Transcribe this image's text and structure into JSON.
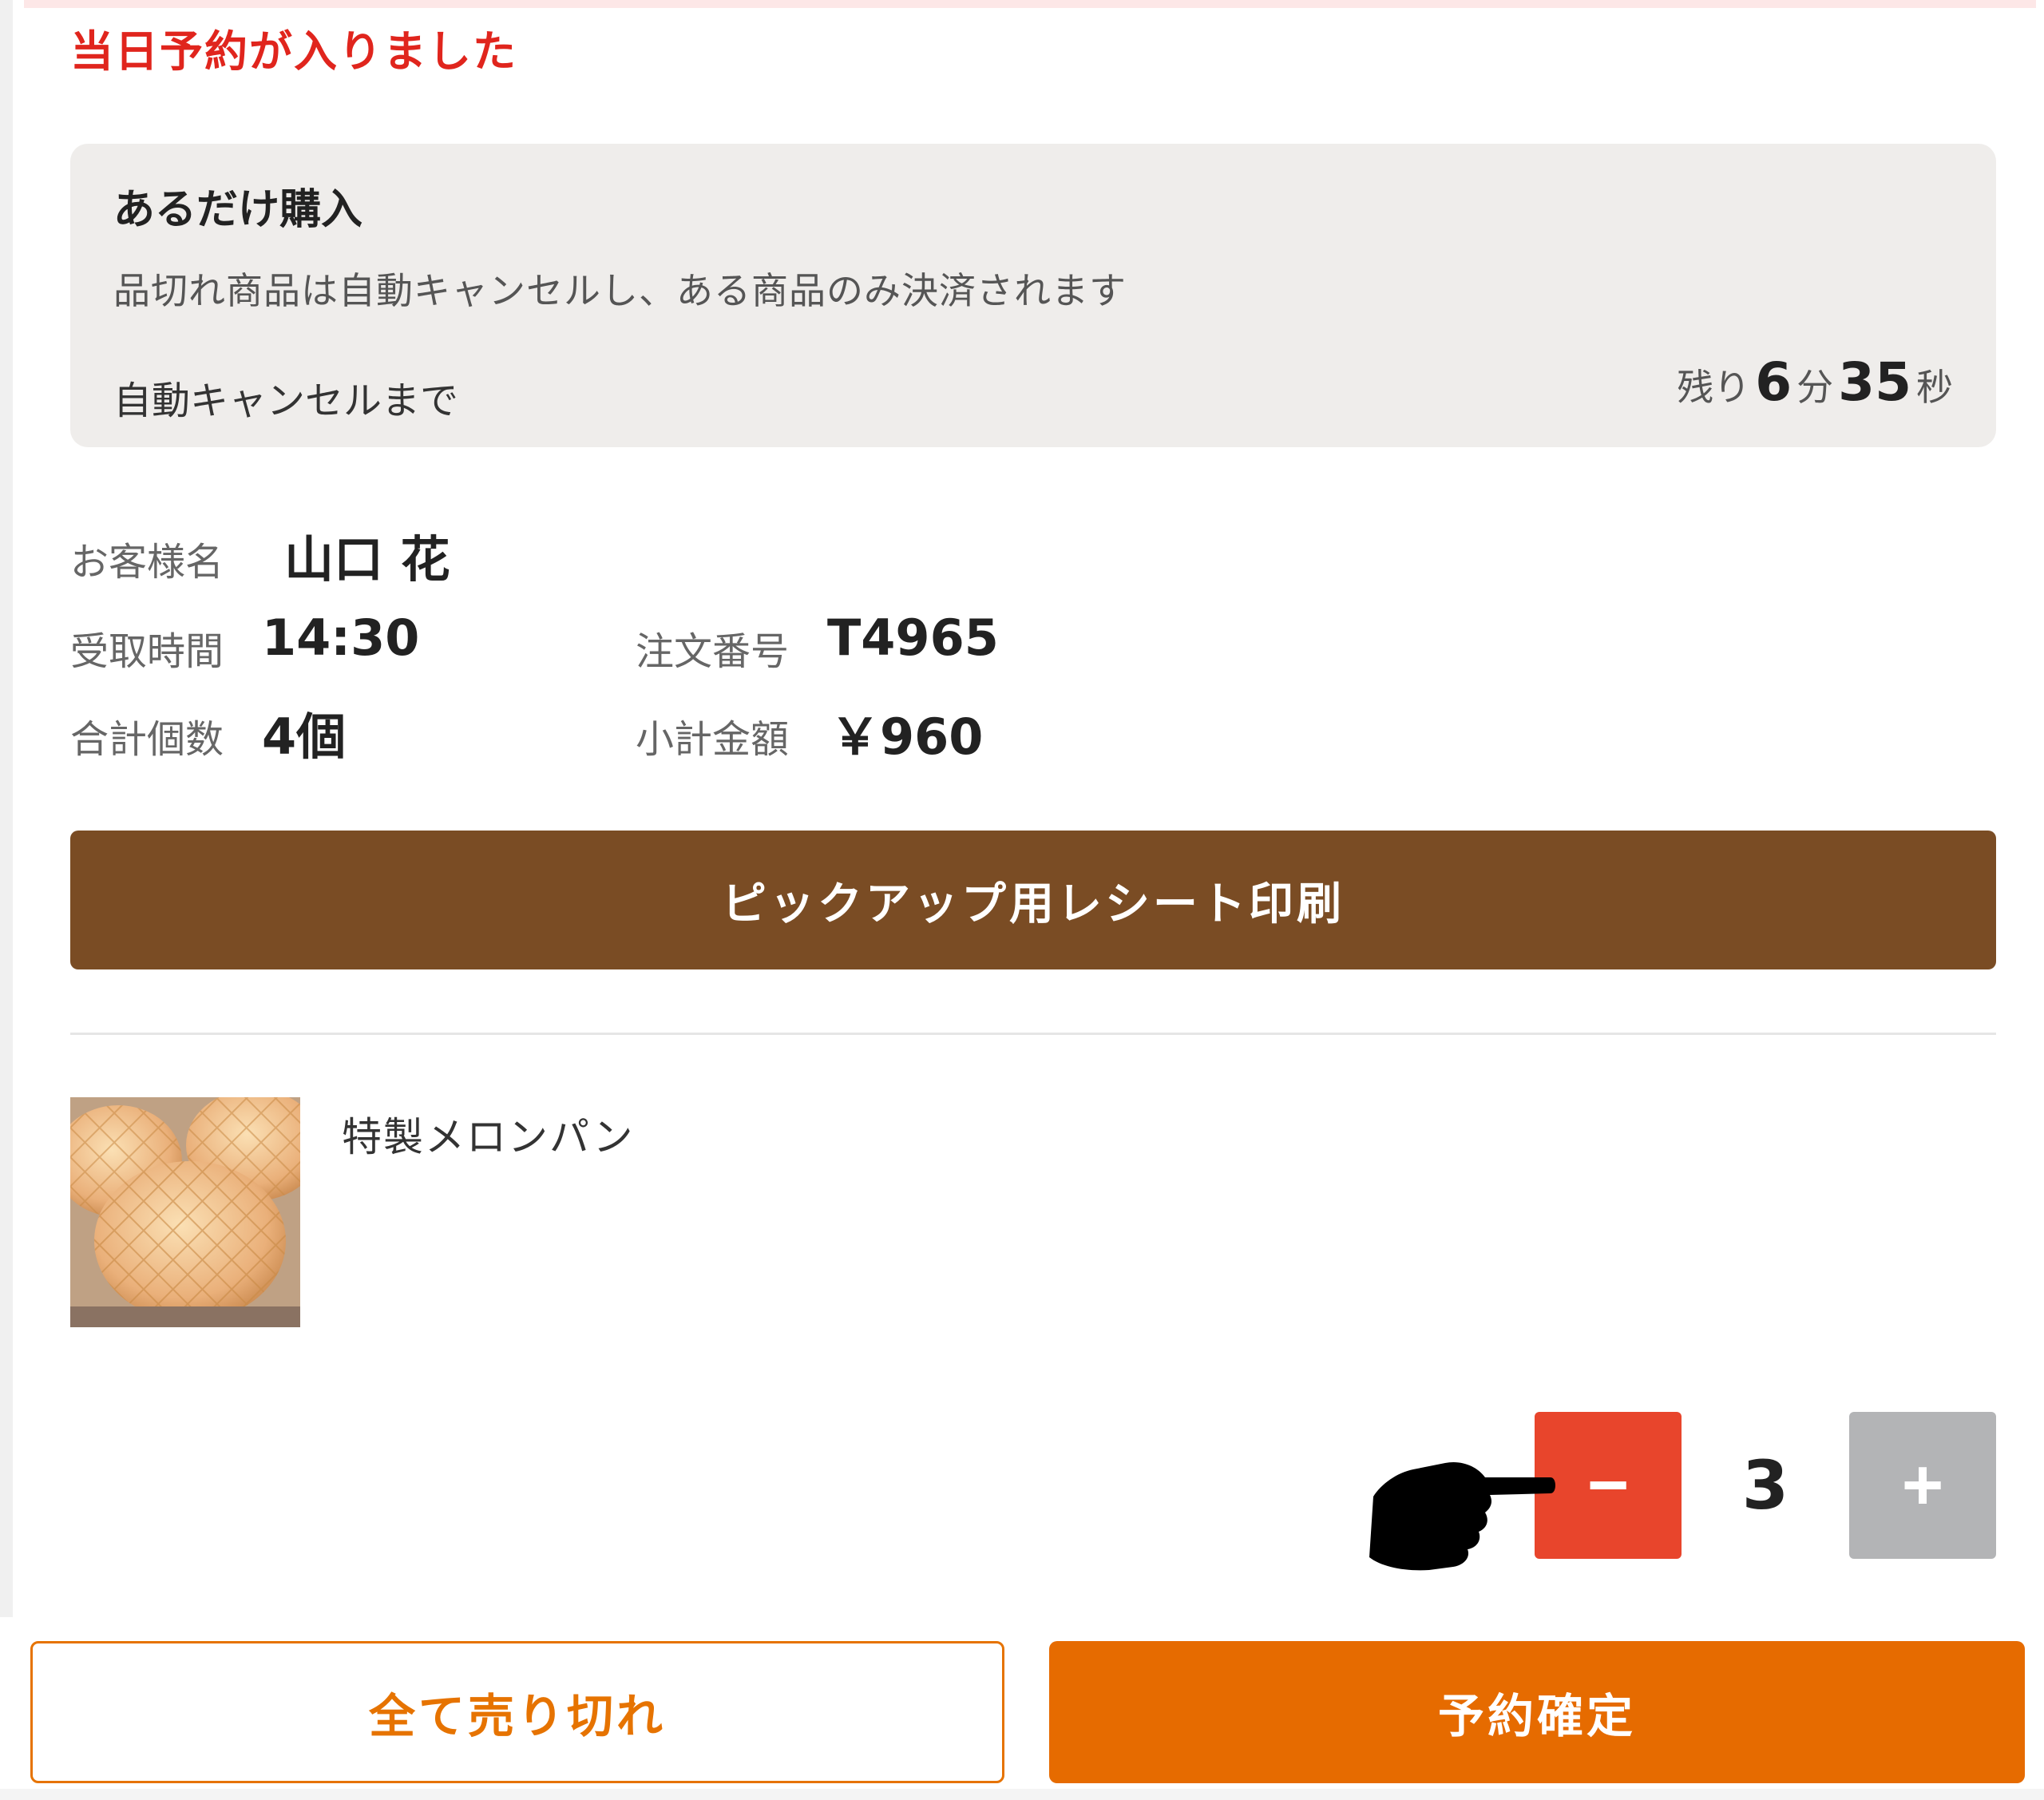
{
  "alert": {
    "title": "当日予約が入りました"
  },
  "notice": {
    "title": "あるだけ購入",
    "description": "品切れ商品は自動キャンセルし、ある商品のみ決済されます",
    "cancel_label": "自動キャンセルまで",
    "countdown": {
      "prefix": "残り",
      "minutes": "6",
      "minutes_unit": "分",
      "seconds": "35",
      "seconds_unit": "秒"
    }
  },
  "order": {
    "customer_label": "お客様名",
    "customer_name": "山口 花",
    "pickup_label": "受取時間",
    "pickup_time": "14:30",
    "order_no_label": "注文番号",
    "order_no": "T4965",
    "total_qty_label": "合計個数",
    "total_qty": "4個",
    "subtotal_label": "小計金額",
    "subtotal": "￥960"
  },
  "actions": {
    "print_receipt": "ピックアップ用レシート印刷",
    "all_sold_out": "全て売り切れ",
    "confirm": "予約確定"
  },
  "product": {
    "name": "特製メロンパン",
    "quantity": "3",
    "minus_glyph": "−",
    "plus_glyph": "+"
  },
  "colors": {
    "alert": "#e0251d",
    "receipt_button": "#7a4c24",
    "accent_orange": "#e66b00",
    "minus_button": "#e8452c",
    "plus_button_disabled": "#b3b4b6"
  }
}
